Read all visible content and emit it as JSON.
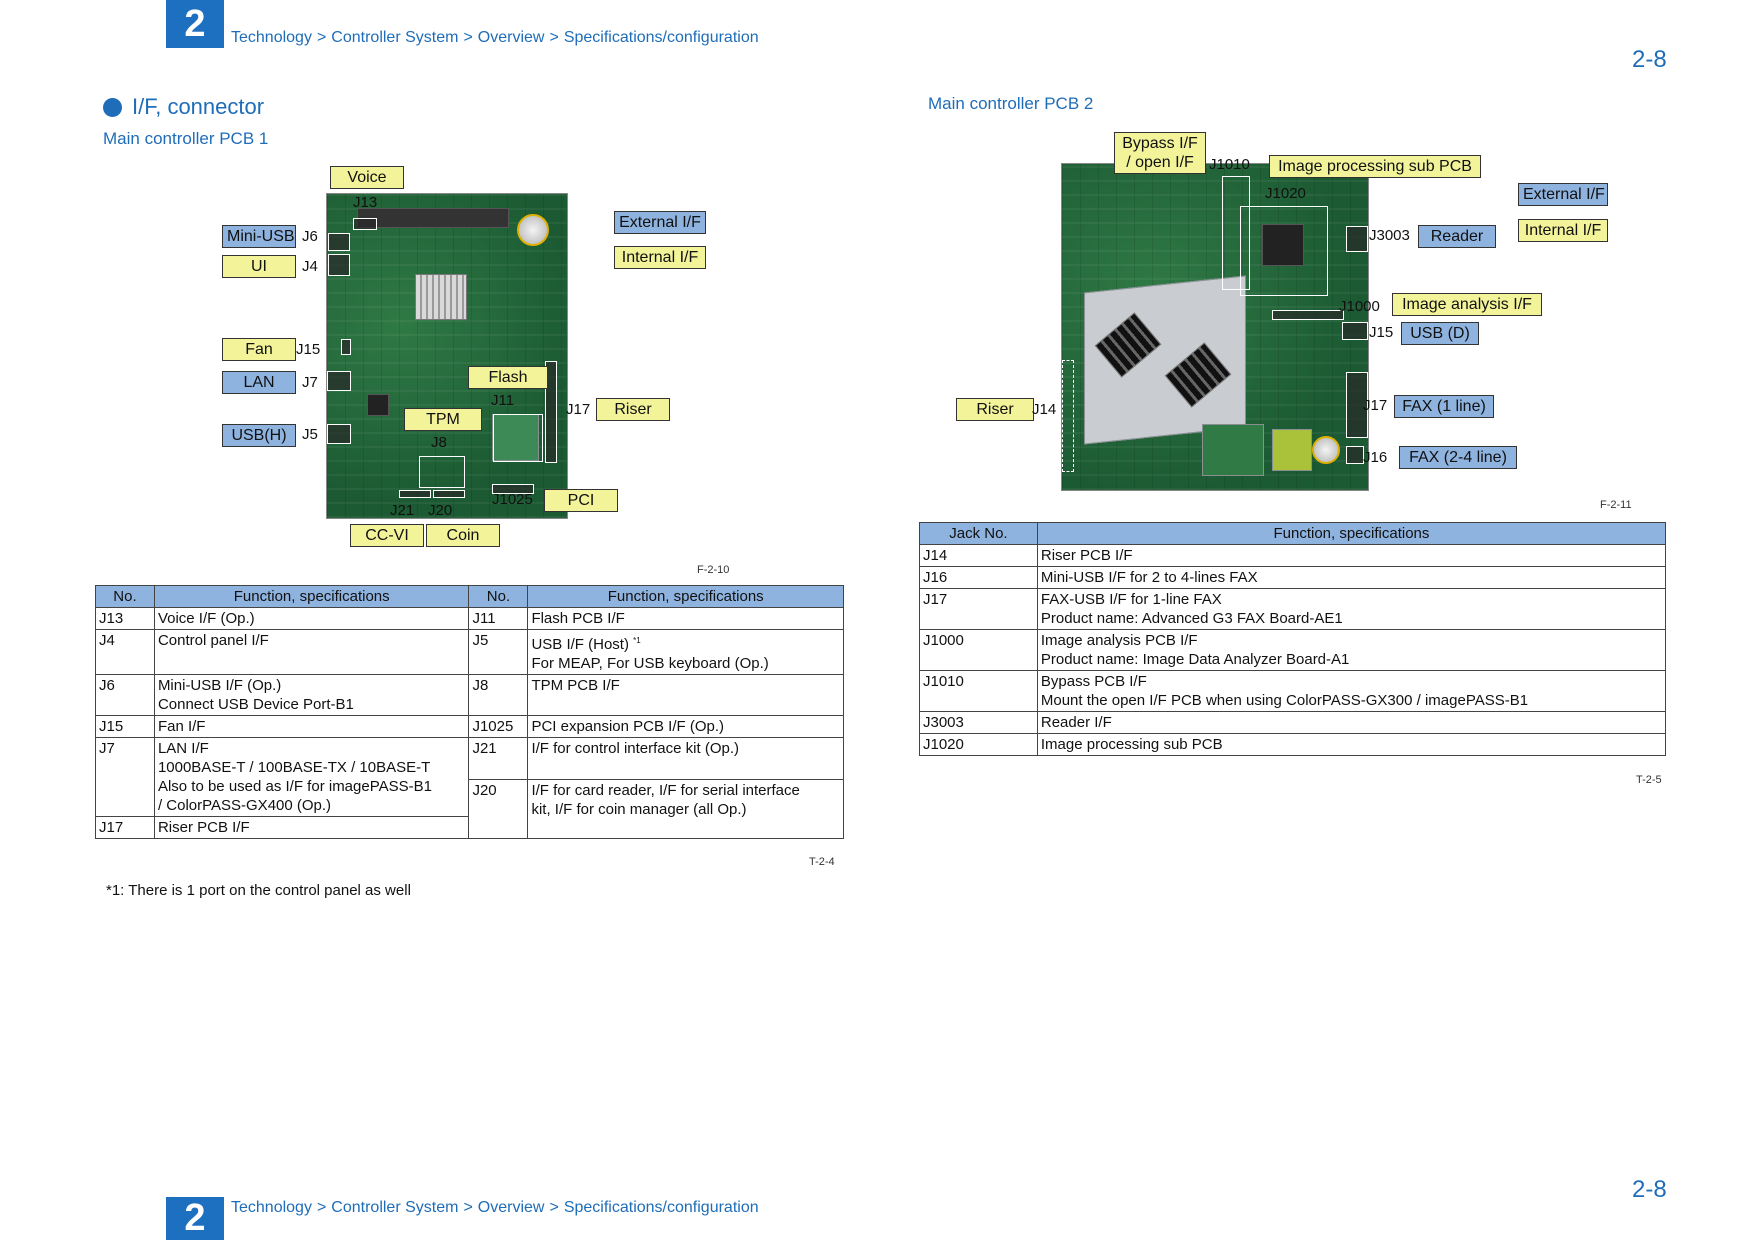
{
  "header": {
    "chapter": "2",
    "breadcrumb": [
      "Technology",
      "Controller System",
      "Overview",
      "Specifications/configuration"
    ],
    "page_number": "2-8"
  },
  "footer": {
    "chapter": "2",
    "breadcrumb": [
      "Technology",
      "Controller System",
      "Overview",
      "Specifications/configuration"
    ],
    "page_number": "2-8"
  },
  "section": {
    "title": "I/F, connector",
    "pcb1_title": "Main controller PCB 1",
    "pcb2_title": "Main controller PCB 2"
  },
  "figure1": {
    "labels": {
      "voice": "Voice",
      "mini_usb": "Mini-USB",
      "ui": "UI",
      "fan": "Fan",
      "lan": "LAN",
      "usbh": "USB(H)",
      "external": "External I/F",
      "internal": "Internal I/F",
      "flash": "Flash",
      "tpm": "TPM",
      "riser": "Riser",
      "pci": "PCI",
      "ccvi": "CC-VI",
      "coin": "Coin"
    },
    "jacks": {
      "j13": "J13",
      "j6": "J6",
      "j4": "J4",
      "j15": "J15",
      "j7": "J7",
      "j5": "J5",
      "j11": "J11",
      "j8": "J8",
      "j17": "J17",
      "j21": "J21",
      "j20": "J20",
      "j1025": "J1025"
    },
    "caption": "F-2-10"
  },
  "figure2": {
    "labels": {
      "bypass": "Bypass I/F\n/ open I/F",
      "img_proc": "Image processing sub PCB",
      "external": "External I/F",
      "internal": "Internal I/F",
      "reader": "Reader",
      "img_analysis": "Image analysis I/F",
      "usbd": "USB (D)",
      "riser": "Riser",
      "fax1": "FAX (1 line)",
      "fax24": "FAX (2-4 line)"
    },
    "jacks": {
      "j1010": "J1010",
      "j1020": "J1020",
      "j3003": "J3003",
      "j1000": "J1000",
      "j15": "J15",
      "j14": "J14",
      "j17": "J17",
      "j16": "J16"
    },
    "caption": "F-2-11"
  },
  "table1": {
    "headers": [
      "No.",
      "Function, specifications",
      "No.",
      "Function, specifications"
    ],
    "rows": {
      "j13": {
        "no": "J13",
        "fn": "Voice I/F (Op.)"
      },
      "j4": {
        "no": "J4",
        "fn": "Control panel I/F"
      },
      "j6": {
        "no": "J6",
        "fn1": "Mini-USB I/F (Op.)",
        "fn2": "Connect USB Device Port-B1"
      },
      "j15": {
        "no": "J15",
        "fn": "Fan I/F"
      },
      "j7": {
        "no": "J7",
        "fn1": "LAN I/F",
        "fn2": "1000BASE-T / 100BASE-TX / 10BASE-T",
        "fn3": "Also to be used as I/F for imagePASS-B1",
        "fn4": "/  ColorPASS-GX400 (Op.)"
      },
      "j17": {
        "no": "J17",
        "fn": "Riser PCB I/F"
      },
      "j11": {
        "no": "J11",
        "fn": "Flash PCB I/F"
      },
      "j5": {
        "no": "J5",
        "fn1": "USB I/F (Host)",
        "sup": "*1",
        "fn2": "For MEAP, For USB keyboard (Op.)"
      },
      "j8": {
        "no": "J8",
        "fn": "TPM PCB I/F"
      },
      "j1025": {
        "no": "J1025",
        "fn": "PCI expansion PCB I/F (Op.)"
      },
      "j21": {
        "no": "J21",
        "fn": "I/F for control interface kit (Op.)"
      },
      "j20": {
        "no": "J20",
        "fn1": "I/F for card reader, I/F for serial interface",
        "fn2": "kit, I/F for coin manager (all Op.)"
      }
    },
    "caption": "T-2-4",
    "footnote": "*1: There is 1 port on the control panel as well"
  },
  "table2": {
    "headers": [
      "Jack No.",
      "Function, specifications"
    ],
    "rows": {
      "j14": {
        "no": "J14",
        "fn": "Riser PCB I/F"
      },
      "j16": {
        "no": "J16",
        "fn": "Mini-USB I/F  for 2 to 4-lines FAX"
      },
      "j17": {
        "no": "J17",
        "fn1": "FAX-USB I/F  for 1-line FAX",
        "fn2": "Product name: Advanced G3 FAX Board-AE1"
      },
      "j1000": {
        "no": "J1000",
        "fn1": "Image analysis PCB I/F",
        "fn2": "Product name: Image Data Analyzer Board-A1"
      },
      "j1010": {
        "no": "J1010",
        "fn1": "Bypass PCB I/F",
        "fn2": "Mount the open I/F PCB when using ColorPASS-GX300 / imagePASS-B1"
      },
      "j3003": {
        "no": "J3003",
        "fn": "Reader I/F"
      },
      "j1020": {
        "no": "J1020",
        "fn": "Image processing sub PCB"
      }
    },
    "caption": "T-2-5"
  }
}
